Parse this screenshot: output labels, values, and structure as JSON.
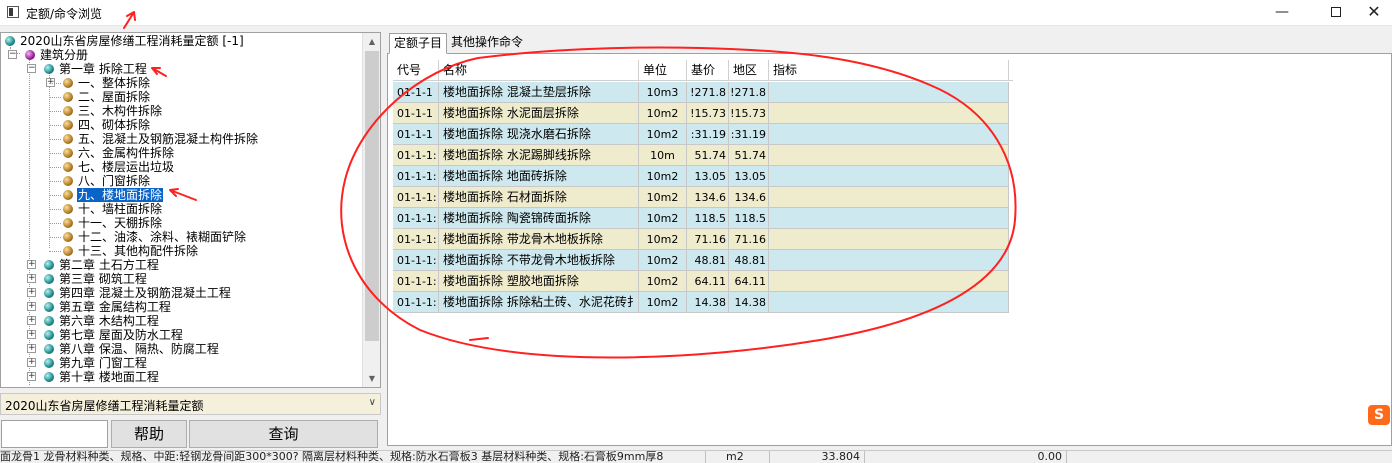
{
  "window": {
    "title": "定额/命令浏览",
    "min": "—",
    "close": "✕"
  },
  "tree": {
    "root": "2020山东省房屋修缮工程消耗量定额 [-1]",
    "section": "建筑分册",
    "chapter1": "第一章 拆除工程",
    "chapter1_items": [
      "一、整体拆除",
      "二、屋面拆除",
      "三、木构件拆除",
      "四、砌体拆除",
      "五、混凝土及钢筋混凝土构件拆除",
      "六、金属构件拆除",
      "七、楼层运出垃圾",
      "八、门窗拆除",
      "九、楼地面拆除",
      "十、墙柱面拆除",
      "十一、天棚拆除",
      "十二、油漆、涂料、裱糊面铲除",
      "十三、其他构配件拆除"
    ],
    "selected_index": 8,
    "chapters": [
      "第二章 土石方工程",
      "第三章 砌筑工程",
      "第四章 混凝土及钢筋混凝土工程",
      "第五章 金属结构工程",
      "第六章 木结构工程",
      "第七章 屋面及防水工程",
      "第八章 保温、隔热、防腐工程",
      "第九章 门窗工程",
      "第十章 楼地面工程"
    ]
  },
  "combo": {
    "value": "2020山东省房屋修缮工程消耗量定额"
  },
  "buttons": {
    "help": "帮助",
    "query": "查询"
  },
  "tabs": [
    "定额子目",
    "其他操作命令"
  ],
  "grid": {
    "headers": [
      "代号",
      "名称",
      "单位",
      "基价",
      "地区",
      "指标"
    ],
    "rows": [
      [
        "01-1-1",
        "楼地面拆除 混凝土垫层拆除",
        "10m3",
        "!271.8",
        "!271.8"
      ],
      [
        "01-1-1",
        "楼地面拆除 水泥面层拆除",
        "10m2",
        "!15.73",
        "!15.73"
      ],
      [
        "01-1-1",
        "楼地面拆除 现浇水磨石拆除",
        "10m2",
        ":31.19",
        ":31.19"
      ],
      [
        "01-1-1:",
        "楼地面拆除 水泥踢脚线拆除",
        "10m",
        "51.74",
        "51.74"
      ],
      [
        "01-1-1:",
        "楼地面拆除 地面砖拆除",
        "10m2",
        "13.05",
        "13.05"
      ],
      [
        "01-1-1:",
        "楼地面拆除 石材面拆除",
        "10m2",
        "134.6",
        "134.6"
      ],
      [
        "01-1-1:",
        "楼地面拆除 陶瓷锦砖面拆除",
        "10m2",
        "118.5",
        "118.5"
      ],
      [
        "01-1-1:",
        "楼地面拆除 带龙骨木地板拆除",
        "10m2",
        "71.16",
        "71.16"
      ],
      [
        "01-1-1:",
        "楼地面拆除 不带龙骨木地板拆除",
        "10m2",
        "48.81",
        "48.81"
      ],
      [
        "01-1-1:",
        "楼地面拆除 塑胶地面拆除",
        "10m2",
        "64.11",
        "64.11"
      ],
      [
        "01-1-1:",
        "楼地面拆除 拆除粘土砖、水泥花砖扌",
        "10m2",
        "14.38",
        "14.38"
      ]
    ]
  },
  "status": {
    "desc": "面龙骨1 龙骨材料种类、规格、中距:轻钢龙骨间距300*300? 隔离层材料种类、规格:防水石膏板3 基层材料种类、规格:石膏板9mm厚8",
    "unit": "m2",
    "qty": "33.804",
    "price": "0.00"
  },
  "colors": {
    "annotation": "#ff2020",
    "row_odd": "#cde9ef",
    "row_even": "#efebcd",
    "selection": "#0a64c8"
  },
  "icons": [
    "app-icon",
    "minimize-icon",
    "maximize-icon",
    "close-icon",
    "expand-icon",
    "chapter-ball-icon",
    "sogou-ime-icon"
  ]
}
